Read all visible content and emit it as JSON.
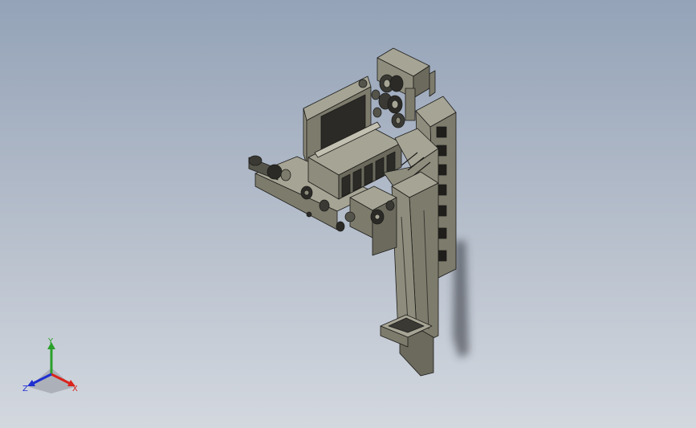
{
  "viewport": {
    "background_top": "#94a3b8",
    "background_bottom": "#d3d8df"
  },
  "model": {
    "body_color": "#7d7b6c",
    "dark_color": "#2b2a26",
    "light_color": "#a6a494",
    "edge_color": "#1c1c1a"
  },
  "triad": {
    "x_label": "X",
    "y_label": "Y",
    "z_label": "Z",
    "x_color": "#d9241c",
    "y_color": "#2aa02a",
    "z_color": "#1f2fd0"
  }
}
